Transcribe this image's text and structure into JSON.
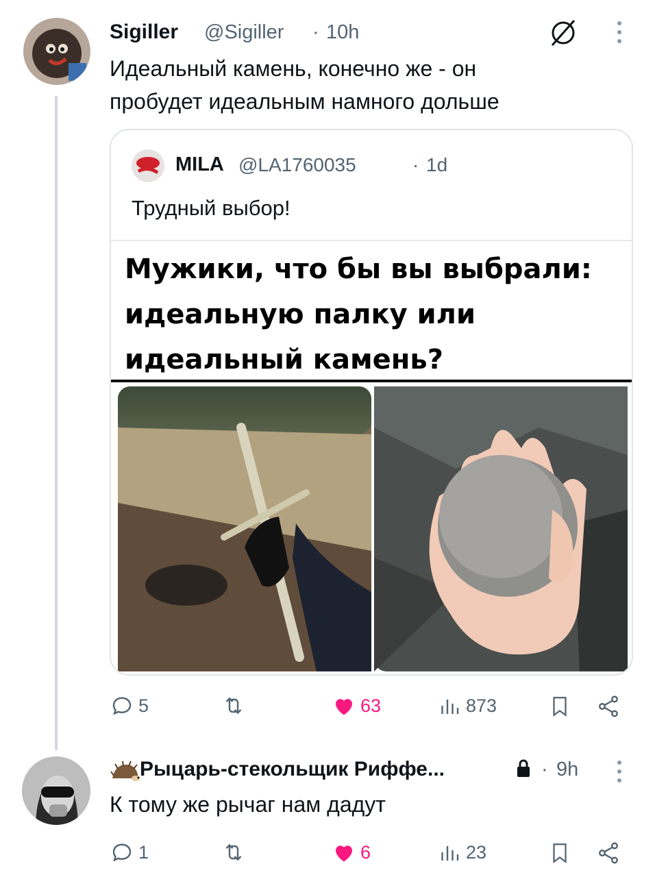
{
  "post": {
    "display_name": "Sigiller",
    "handle": "@Sigiller",
    "time": "10h",
    "text_line1": "Идеальный камень, конечно же - он",
    "text_line2": "пробудет идеальным намного дольше",
    "quote": {
      "display_name": "MILA",
      "handle": "@LA1760035",
      "time": "1d",
      "text": "Трудный выбор!",
      "meme_line1": "Мужики, что бы вы выбрали:",
      "meme_line2": "идеальную палку или",
      "meme_line3": "идеальный камень?"
    },
    "stats": {
      "replies": "5",
      "reposts": "",
      "likes": "63",
      "views": "873"
    }
  },
  "reply": {
    "display_name": "Рыцарь-стекольщик Риффе...",
    "time": "9h",
    "text": "К тому же рычаг нам дадут",
    "stats": {
      "replies": "1",
      "reposts": "",
      "likes": "6",
      "views": "23"
    }
  },
  "icons": {
    "reply": "reply-icon",
    "repost": "repost-icon",
    "like": "heart-icon",
    "views": "views-icon",
    "bookmark": "bookmark-icon",
    "share": "share-icon",
    "more": "more-icon",
    "grok": "slash-circle-icon",
    "lock": "lock-icon"
  },
  "colors": {
    "like": "#f91880",
    "muted": "#536471",
    "text": "#0f1419"
  }
}
